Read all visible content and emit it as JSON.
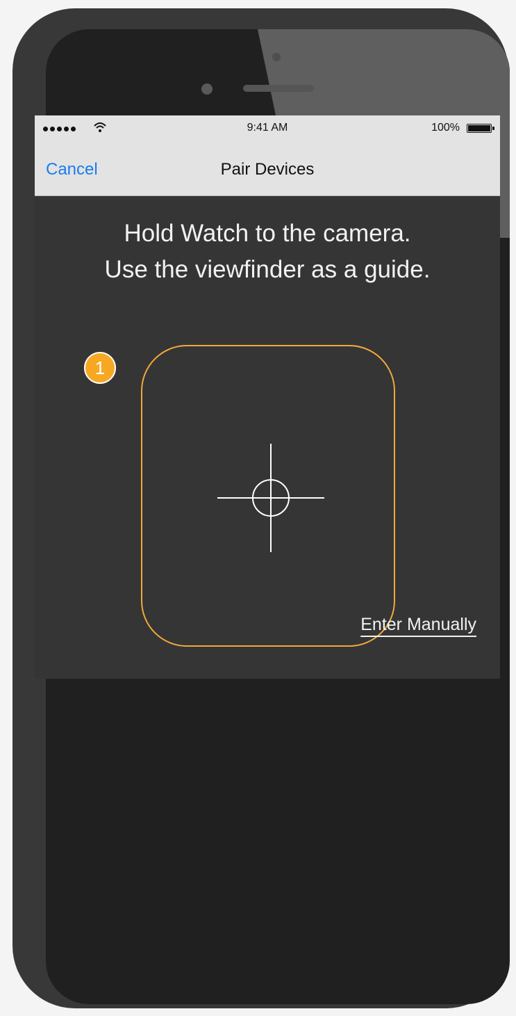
{
  "status_bar": {
    "time": "9:41 AM",
    "battery_percent": "100%",
    "signal_bars": 5,
    "battery_level": 1.0
  },
  "nav": {
    "cancel_label": "Cancel",
    "title": "Pair Devices"
  },
  "instruction": {
    "line1": "Hold Watch to the camera.",
    "line2": "Use the viewfinder as a guide."
  },
  "step_badge": "1",
  "enter_manually_label": "Enter Manually",
  "colors": {
    "accent_link": "#1a7cf0",
    "viewfinder_border": "#f2a93b",
    "badge": "#f7a823",
    "screen_background": "#353535",
    "bar_background": "#e3e3e3"
  },
  "icons": [
    "wifi-icon",
    "battery-icon",
    "crosshair-icon"
  ]
}
